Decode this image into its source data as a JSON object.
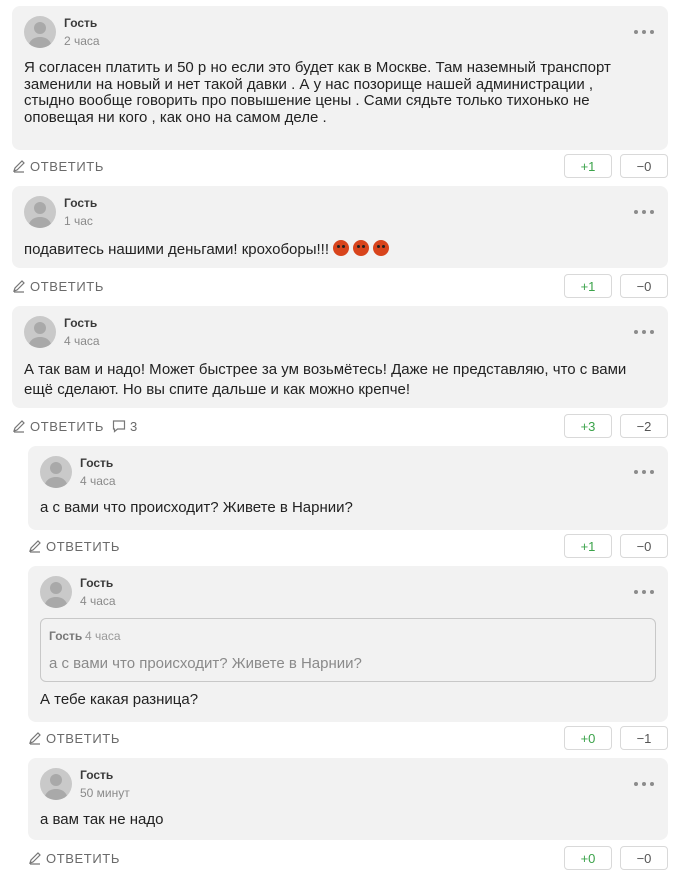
{
  "labels": {
    "reply": "ОТВЕТИТЬ"
  },
  "comments": [
    {
      "author": "Гость",
      "time": "2 часа",
      "lines": [
        "Я согласен платить и 50 р но если это будет как в Москве. Там наземный транспорт",
        "заменили на новый и нет такой давки . А у нас позорище нашей администрации ,",
        "стыдно вообще говорить про повышение цены . Сами сядьте только тихонько не",
        "оповещая ни кого , как оно на самом деле ."
      ],
      "upvotes": "+1",
      "downvotes": "−0"
    },
    {
      "author": "Гость",
      "time": "1 час",
      "text": "подавитесь нашими деньгами! крохоборы!!!",
      "emoji_icons": [
        "angry-face-emoji",
        "angry-face-emoji",
        "angry-face-emoji"
      ],
      "upvotes": "+1",
      "downvotes": "−0"
    },
    {
      "author": "Гость",
      "time": "4 часа",
      "lines": [
        "А так вам и надо! Может быстрее за ум возьмётесь! Даже не представляю, что с вами",
        "ещё сделают. Но вы спите дальше и как можно крепче!"
      ],
      "replies_count": "3",
      "upvotes": "+3",
      "downvotes": "−2"
    },
    {
      "author": "Гость",
      "time": "4 часа",
      "text": "а с вами что происходит? Живете в Нарнии?",
      "upvotes": "+1",
      "downvotes": "−0"
    },
    {
      "author": "Гость",
      "time": "4 часа",
      "quote": {
        "author": "Гость",
        "time": "4 часа",
        "text": "а с вами что происходит? Живете в Нарнии?"
      },
      "text": "А тебе какая разница?",
      "upvotes": "+0",
      "downvotes": "−1"
    },
    {
      "author": "Гость",
      "time": "50 минут",
      "text": "а вам так не надо",
      "upvotes": "+0",
      "downvotes": "−0"
    }
  ],
  "colors": {
    "card_bg": "#f2f2f2",
    "upvote": "#3ba34a",
    "avatar": "#c9c9c9"
  },
  "icons": {
    "reply": "pencil-icon",
    "replies": "speech-bubble-icon",
    "menu": "more-dots-icon"
  }
}
